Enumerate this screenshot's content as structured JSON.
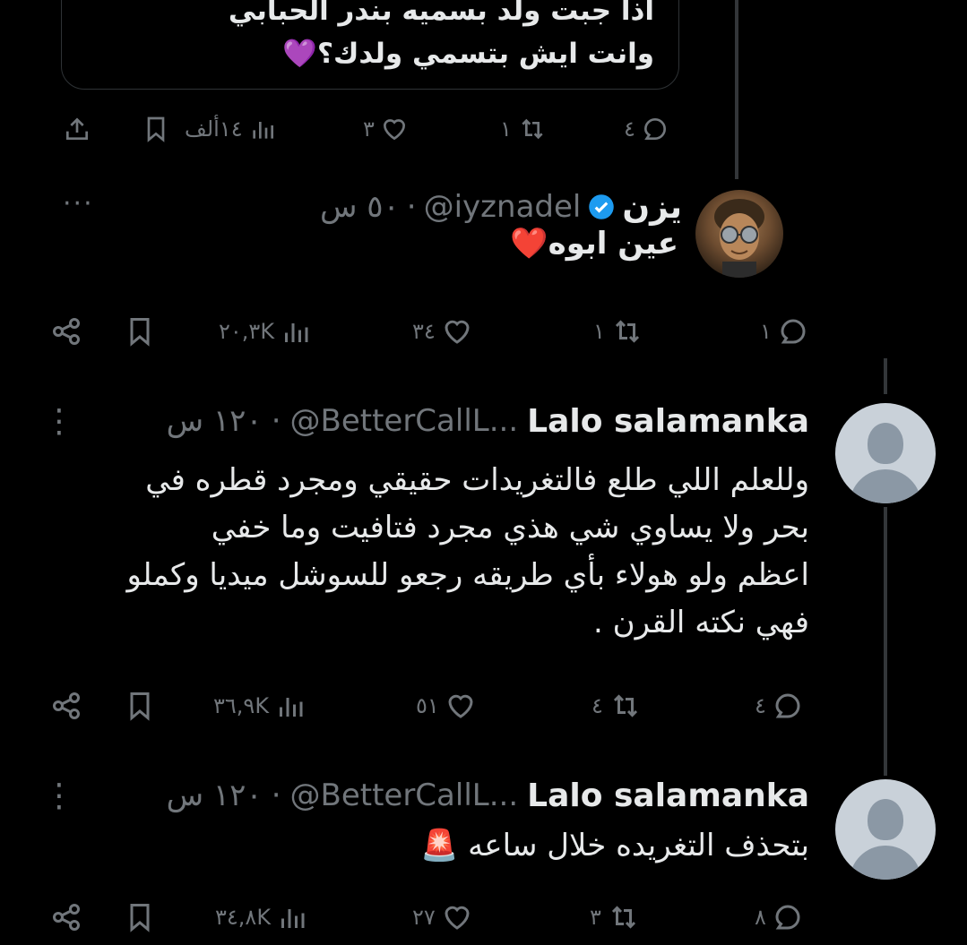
{
  "quoted": {
    "line1": "اذا جبت ولد بسميه بندر الحبابي",
    "line2": "وانت ايش بتسمي ولدك؟💜"
  },
  "quoted_actions": {
    "replies": "٤",
    "reposts": "١",
    "likes": "٣",
    "views": "١٤ألف"
  },
  "reply1": {
    "name": "يزن",
    "handle": "@iyznadel",
    "time": "٥٠ س",
    "separator": "·",
    "text": "عين ابوه❤️",
    "more": "···",
    "actions": {
      "replies": "١",
      "reposts": "١",
      "likes": "٣٤",
      "views": "٢٠,٣K"
    }
  },
  "reply2": {
    "name": "Lalo salamanka",
    "handle": "@BetterCallL...",
    "time": "١٢٠ س",
    "separator": "·",
    "more": "⋮",
    "lines": [
      "وللعلم اللي طلع فالتغريدات حقيقي ومجرد قطره في",
      "بحر ولا يساوي شي هذي مجرد فتافيت وما خفي",
      "اعظم ولو هولاء بأي طريقه رجعو للسوشل ميديا وكملو",
      "فهي نكته القرن ."
    ],
    "actions": {
      "replies": "٤",
      "reposts": "٤",
      "likes": "٥١",
      "views": "٣٦,٩K"
    }
  },
  "reply3": {
    "name": "Lalo salamanka",
    "handle": "@BetterCallL...",
    "time": "١٢٠ س",
    "separator": "·",
    "more": "⋮",
    "text": "بتحذف التغريده خلال ساعه 🚨",
    "actions": {
      "replies": "٨",
      "reposts": "٣",
      "likes": "٢٧",
      "views": "٣٤,٨K"
    }
  },
  "colors": {
    "background": "#000000",
    "muted": "#71767b",
    "text": "#e7e9ea",
    "verified": "#1d9bf0"
  }
}
